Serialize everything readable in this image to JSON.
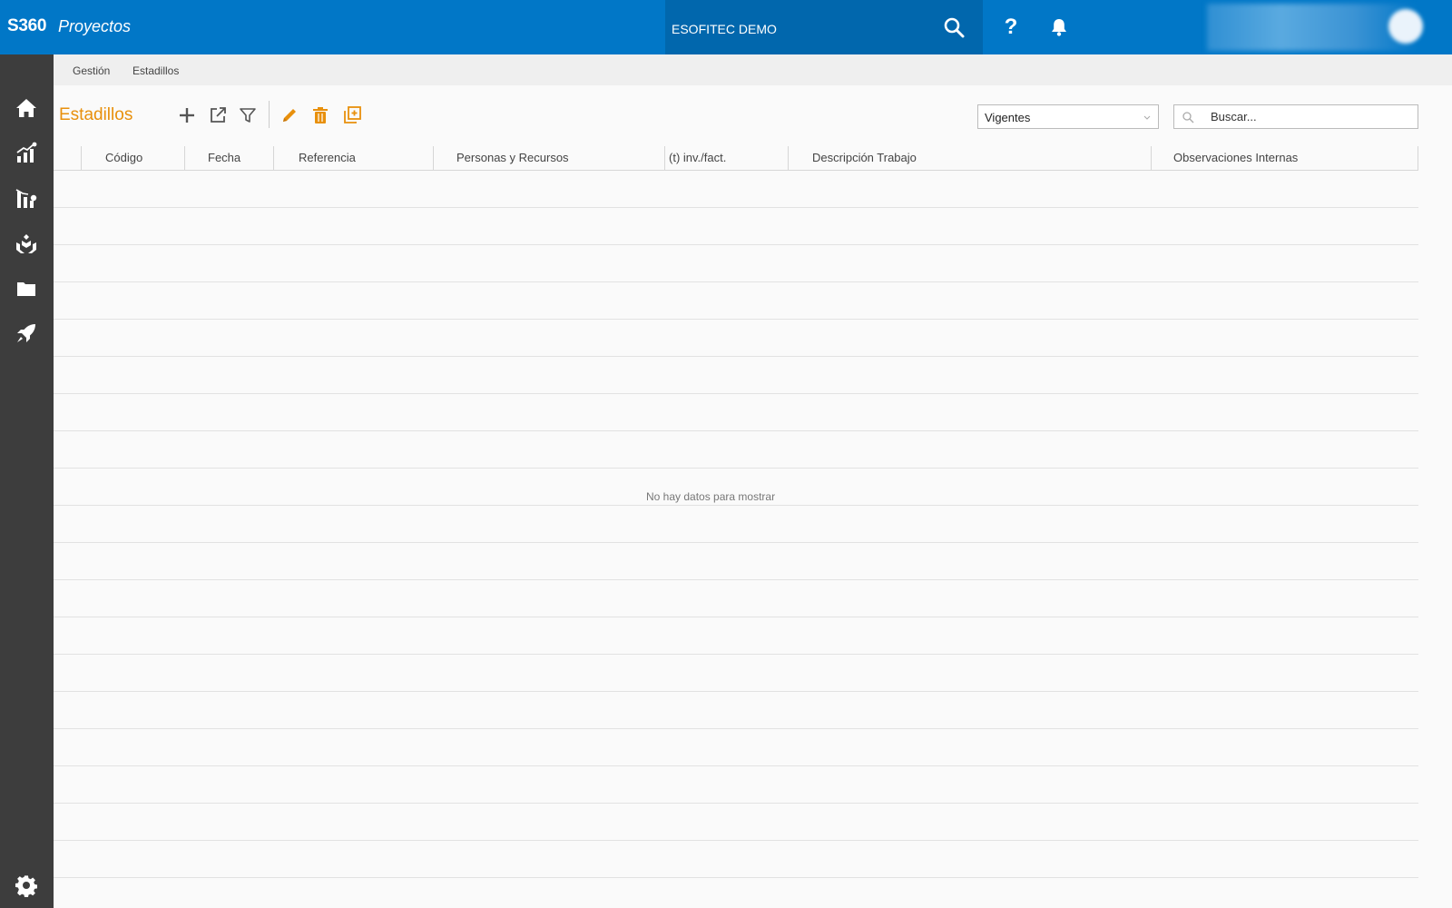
{
  "app": {
    "brand": "S360",
    "module": "Proyectos",
    "company": "ESOFITEC DEMO",
    "help_label": "?"
  },
  "breadcrumb": {
    "items": [
      "Gestión",
      "Estadillos"
    ]
  },
  "page": {
    "title": "Estadillos"
  },
  "toolbar": {
    "actions": [
      "add-icon",
      "open-external-icon",
      "filter-icon",
      "edit-icon",
      "delete-icon",
      "duplicate-icon"
    ]
  },
  "filter": {
    "selected": "Vigentes"
  },
  "search": {
    "placeholder": "Buscar..."
  },
  "table": {
    "columns": [
      "Código",
      "Fecha",
      "Referencia",
      "Personas y Recursos",
      "(t) inv./fact.",
      "Descripción Trabajo",
      "Observaciones Internas"
    ],
    "rows": [],
    "empty_message": "No hay datos para mostrar"
  },
  "sidebar": {
    "items": [
      "home-icon",
      "analytics-chart-icon",
      "stats-chart-icon",
      "hands-care-icon",
      "folder-icon",
      "rocket-icon",
      "settings-gear-icon"
    ]
  },
  "colors": {
    "topbar": "#0177c7",
    "company_bar": "#0167ad",
    "sidebar": "#3d3d3d",
    "accent": "#e8900c"
  }
}
